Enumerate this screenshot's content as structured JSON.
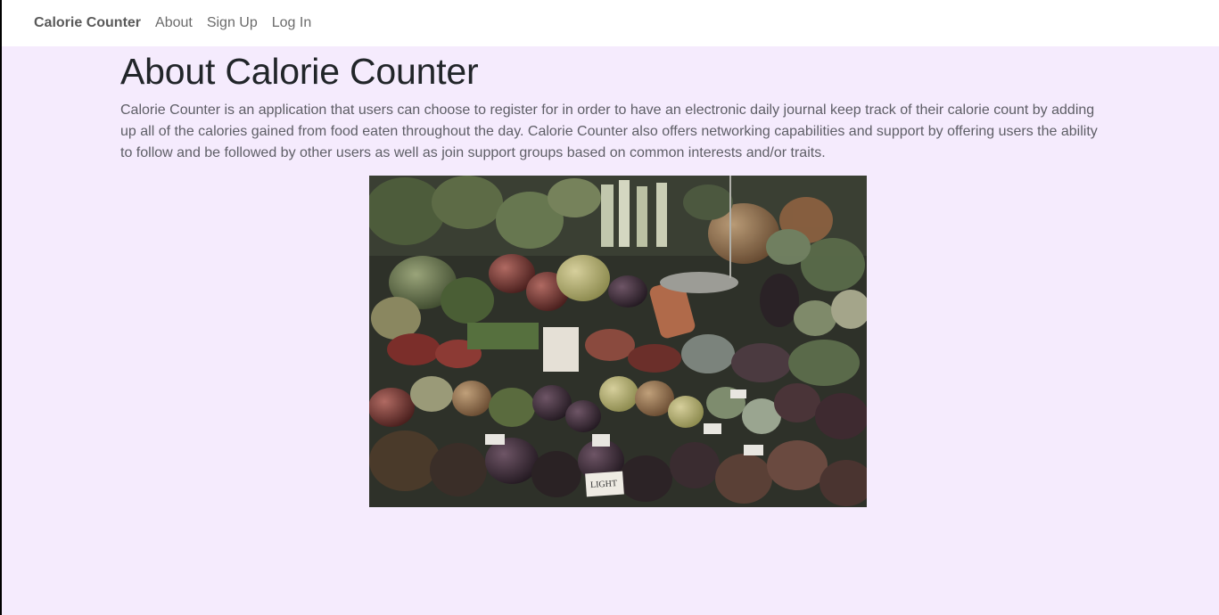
{
  "navbar": {
    "brand": "Calorie Counter",
    "links": [
      "About",
      "Sign Up",
      "Log In"
    ]
  },
  "main": {
    "title": "About Calorie Counter",
    "description": "Calorie Counter is an application that users can choose to register for in order to have an electronic daily journal keep track of their calorie count by adding up all of the calories gained from food eaten throughout the day. Calorie Counter also offers networking capabilities and support by offering users the ability to follow and be followed by other users as well as join support groups based on common interests and/or traits.",
    "image_alt": "Produce market stall with fruits and vegetables",
    "sign_text": "LIGHT"
  },
  "colors": {
    "page_background": "#f5ebfd",
    "navbar_background": "#ffffff"
  }
}
